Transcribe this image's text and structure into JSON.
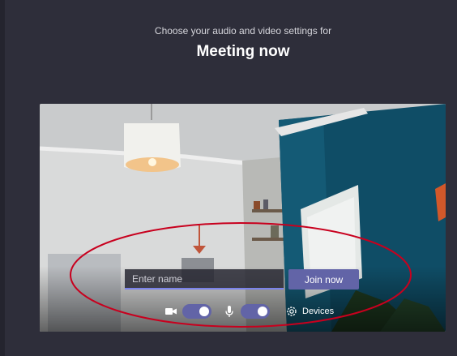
{
  "header": {
    "subtitle": "Choose your audio and video settings for",
    "meeting_title": "Meeting now"
  },
  "join": {
    "name_placeholder": "Enter name",
    "name_value": "",
    "join_label": "Join now"
  },
  "controls": {
    "camera": {
      "icon": "camera-icon",
      "on": true
    },
    "microphone": {
      "icon": "microphone-icon",
      "on": true
    },
    "devices": {
      "icon": "gear-icon",
      "label": "Devices"
    }
  },
  "colors": {
    "background": "#2e2e3a",
    "accent": "#6264a7",
    "annotation": "#c8001e"
  }
}
